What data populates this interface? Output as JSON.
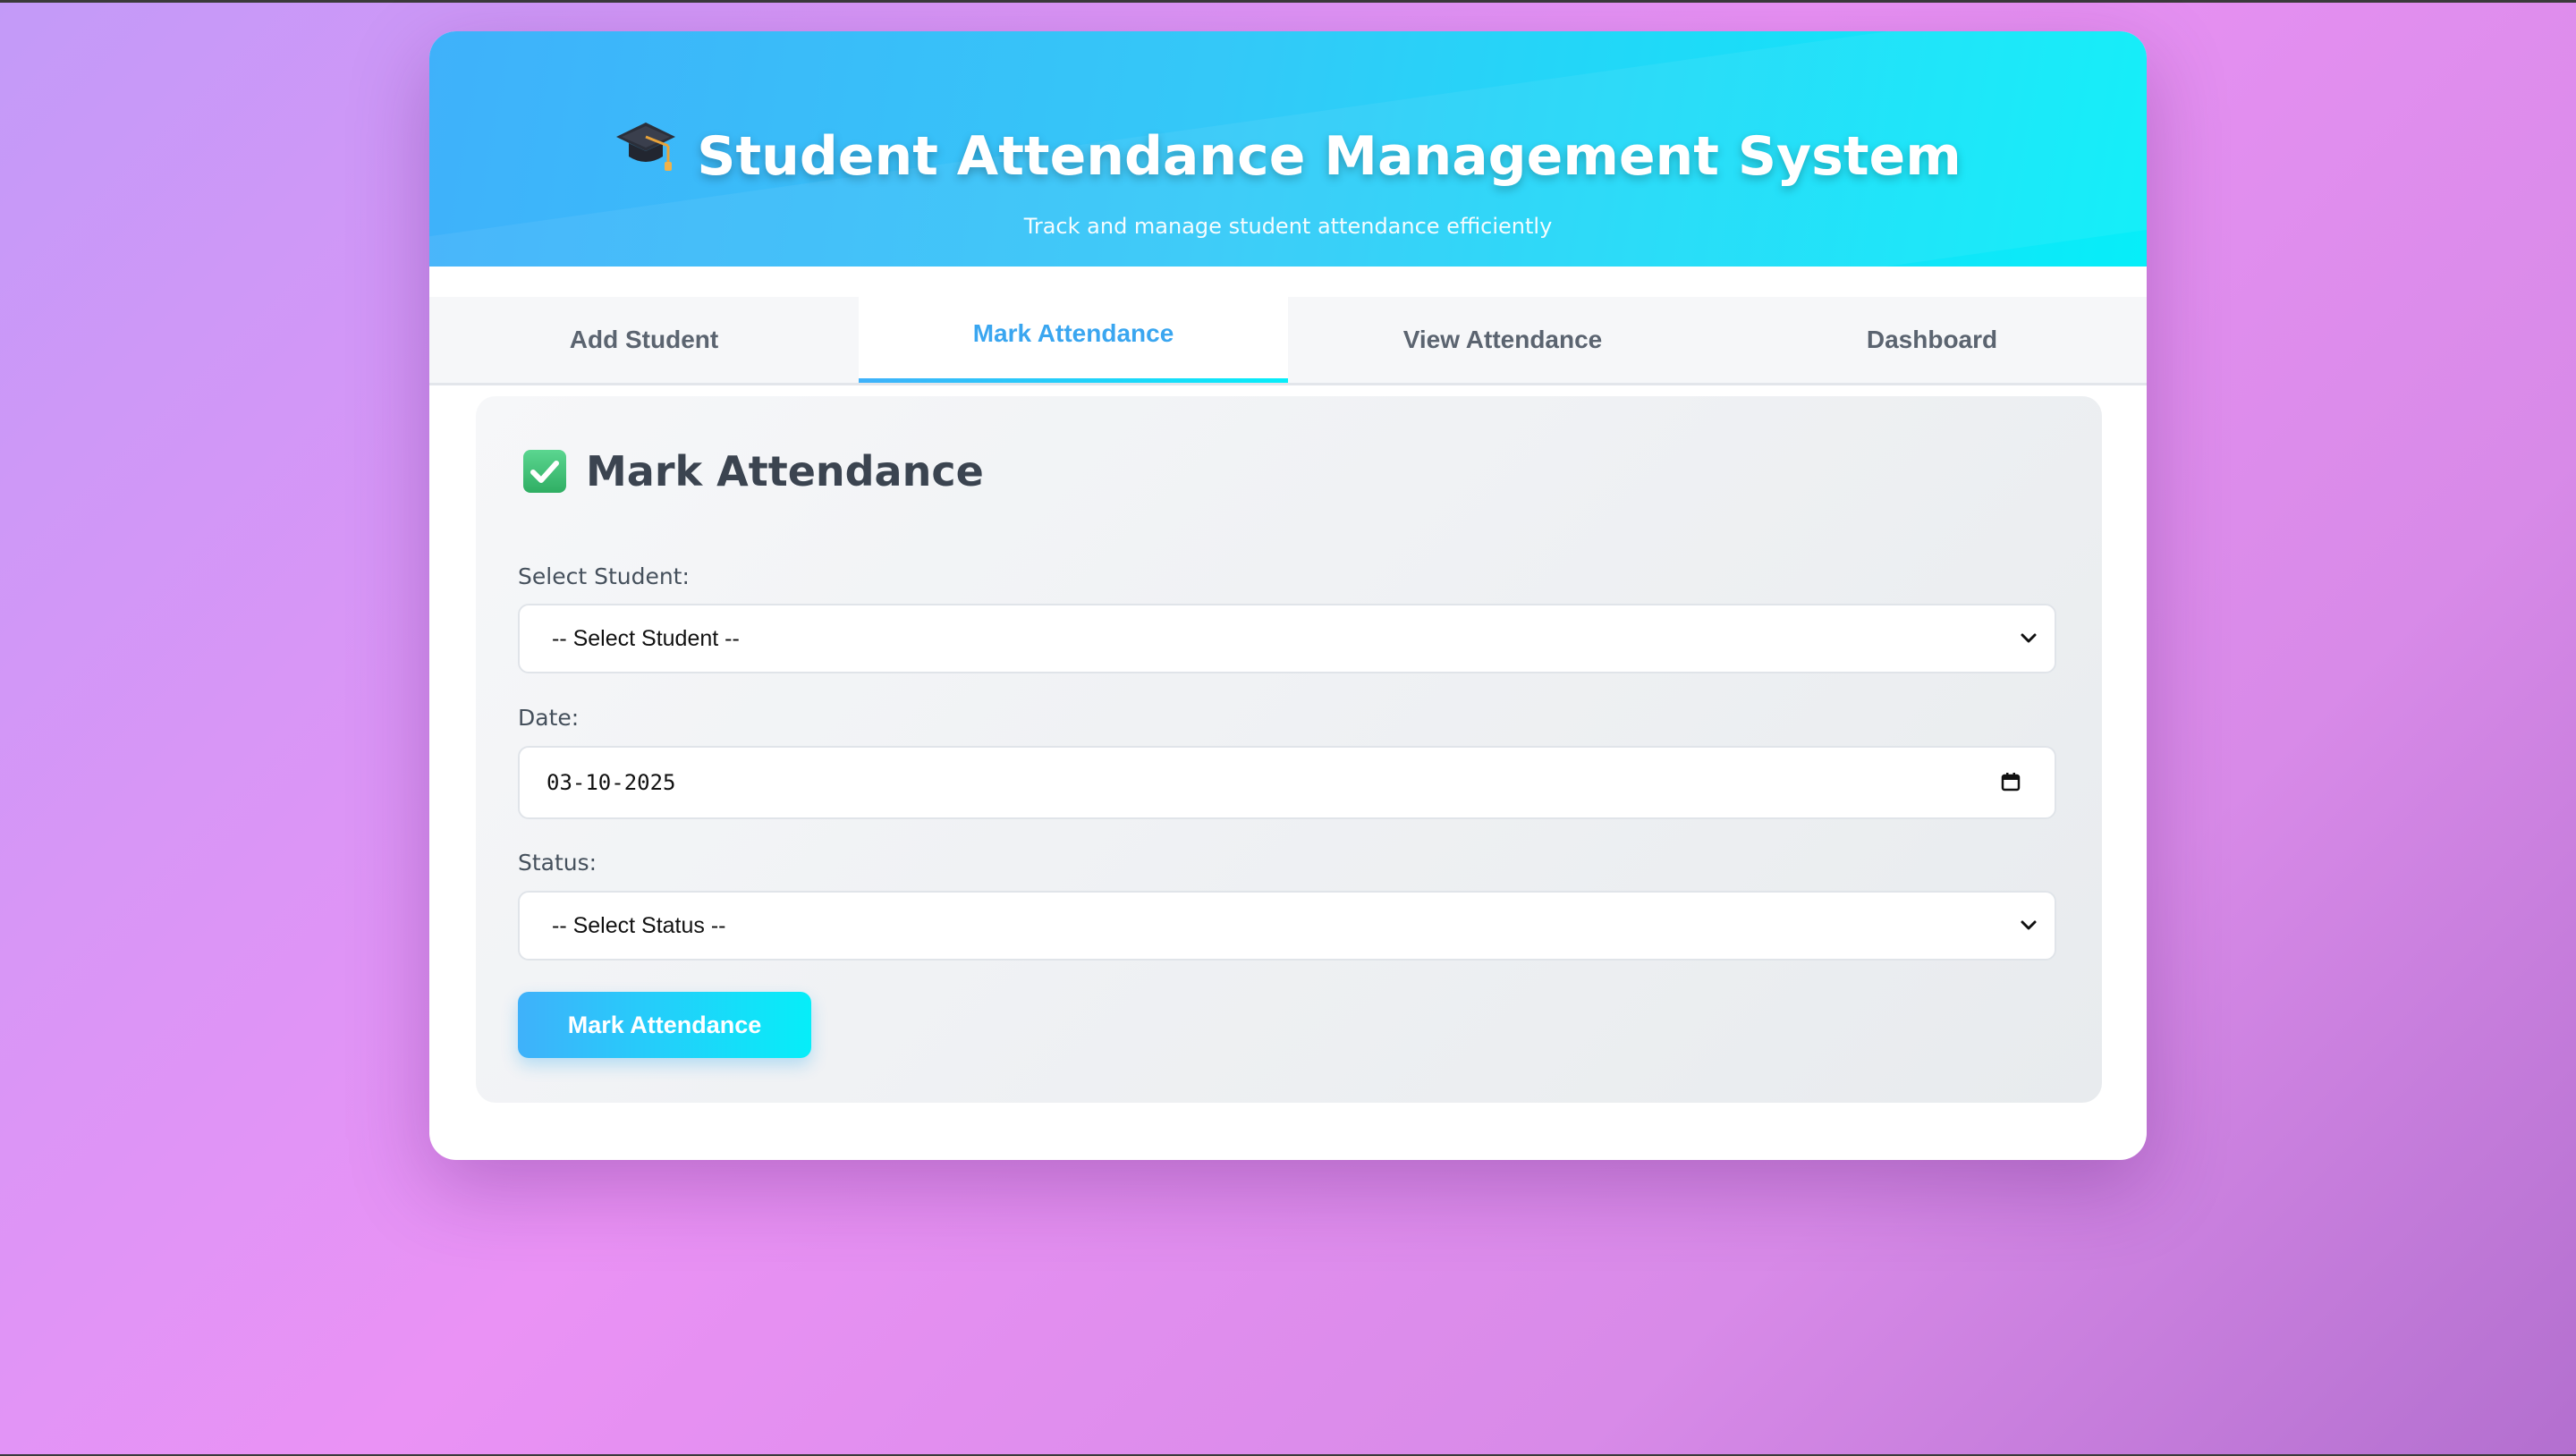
{
  "header": {
    "title": "Student Attendance Management System",
    "subtitle": "Track and manage student attendance efficiently",
    "icon": "graduation-cap-icon"
  },
  "tabs": [
    {
      "label": "Add Student",
      "active": false
    },
    {
      "label": "Mark Attendance",
      "active": true
    },
    {
      "label": "View Attendance",
      "active": false
    },
    {
      "label": "Dashboard",
      "active": false
    }
  ],
  "form": {
    "heading": "Mark Attendance",
    "heading_icon": "checkmark-box-icon",
    "student_label": "Select Student:",
    "student_value": "-- Select Student --",
    "date_label": "Date:",
    "date_value": "03-10-2025",
    "status_label": "Status:",
    "status_value": "-- Select Status --",
    "submit_label": "Mark Attendance"
  },
  "colors": {
    "accent_start": "#3fb1fa",
    "accent_end": "#06eef9",
    "active_tab_text": "#3aa6f0",
    "check_green": "#2fae63"
  }
}
